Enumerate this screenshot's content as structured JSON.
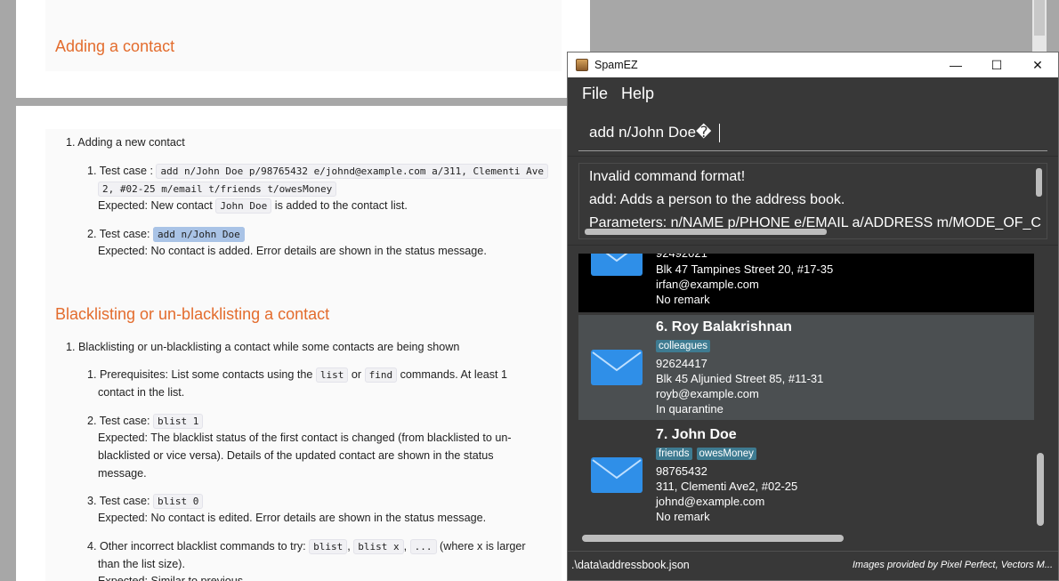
{
  "doc": {
    "top_heading": "Adding a contact",
    "item1": "1. Adding a new contact",
    "t1_prefix": "1. Test case :",
    "t1_code_a": "add n/John Doe p/98765432 e/johnd@example.com a/311, Clementi Ave",
    "t1_code_b": "2, #02-25 m/email t/friends t/owesMoney",
    "t1_expected_pre": "Expected: New contact",
    "t1_expected_code": "John Doe",
    "t1_expected_post": "is added to the contact list.",
    "t2_prefix": "2. Test case:",
    "t2_code": "add n/John Doe",
    "t2_expected": "Expected: No contact is added. Error details are shown in the status message.",
    "section_heading": "Blacklisting or un-blacklisting a contact",
    "b_item1": "1. Blacklisting or un-blacklisting a contact while some contacts are being shown",
    "b1_prefix": "1. Prerequisites: List some contacts using the",
    "b1_code_list": "list",
    "b1_or": "or",
    "b1_code_find": "find",
    "b1_post": "commands. At least 1",
    "b1_line2": "contact in the list.",
    "b2_prefix": "2. Test case:",
    "b2_code": "blist 1",
    "b2_exp1": "Expected: The blacklist status of the first contact is changed (from blacklisted to un-",
    "b2_exp2": "blacklisted or vice versa). Details of the updated contact are shown in the status",
    "b2_exp3": "message.",
    "b3_prefix": "3. Test case:",
    "b3_code": "blist 0",
    "b3_exp": "Expected: No contact is edited. Error details are shown in the status message.",
    "b4_prefix": "4. Other incorrect blacklist commands to try:",
    "b4_code1": "blist",
    "b4_code2": "blist x",
    "b4_code3": "...",
    "b4_post": "(where x is larger",
    "b4_line2": "than the list size).",
    "b4_line3": "Expected: Similar to previous."
  },
  "app": {
    "title": "SpamEZ",
    "win_min": "—",
    "win_max": "☐",
    "win_close": "✕",
    "menu_file": "File",
    "menu_help": "Help",
    "command_value": "add n/John Doe�",
    "result_lines": [
      "Invalid command format!",
      "add: Adds a person to the address book.",
      "Parameters: n/NAME p/PHONE e/EMAIL a/ADDRESS m/MODE_OF_C"
    ],
    "contacts": [
      {
        "phone": "92492021",
        "address": "Blk 47 Tampines Street 20, #17-35",
        "email": "irfan@example.com",
        "remark": "No remark"
      },
      {
        "index_name": "6.  Roy Balakrishnan",
        "tags": [
          "colleagues"
        ],
        "phone": "92624417",
        "address": "Blk 45 Aljunied Street 85, #11-31",
        "email": "royb@example.com",
        "remark": "In quarantine"
      },
      {
        "index_name": "7.  John Doe",
        "tags": [
          "friends",
          "owesMoney"
        ],
        "phone": "98765432",
        "address": "311, Clementi Ave2, #02-25",
        "email": "johnd@example.com",
        "remark": "No remark"
      }
    ],
    "status_path": ".\\data\\addressbook.json",
    "status_credit": "Images provided by Pixel Perfect, Vectors M..."
  },
  "colors": {
    "heading": "#e36c2d",
    "app_bg": "#383838",
    "selected_card": "#4b4f51",
    "black_card": "#000000",
    "tag": "#3e7b91",
    "mail_icon": "#2f8fe8"
  },
  "icons": [
    "mail-icon",
    "app-icon",
    "minimize-icon",
    "maximize-icon",
    "close-icon"
  ]
}
